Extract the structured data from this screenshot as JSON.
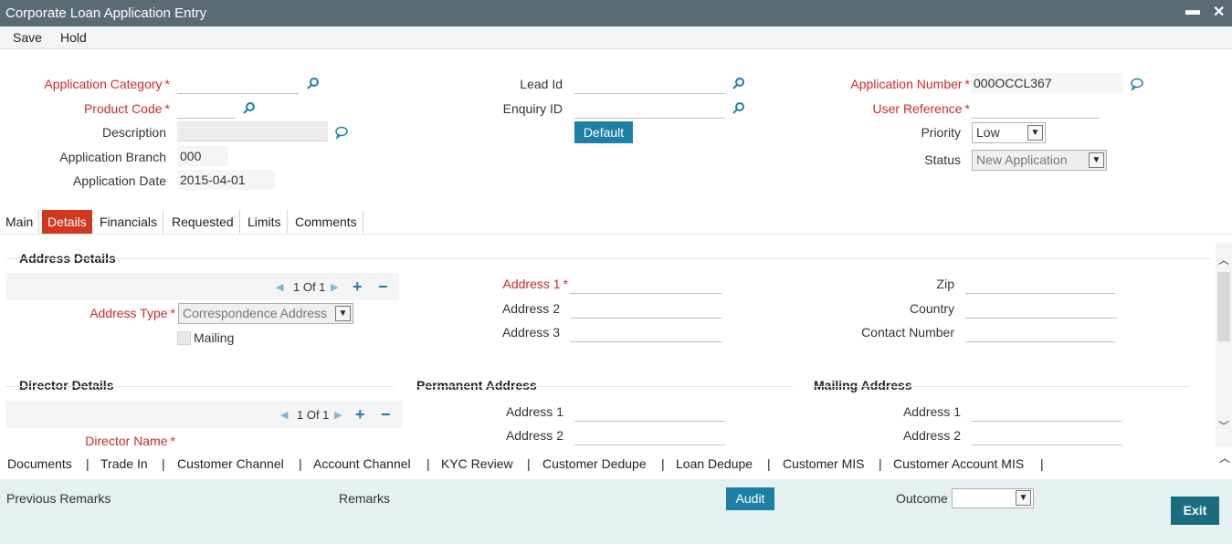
{
  "window": {
    "title": "Corporate Loan Application Entry",
    "minimize": "▬",
    "close": "✕"
  },
  "menu": {
    "save": "Save",
    "hold": "Hold"
  },
  "header": {
    "application_category": {
      "label": "Application Category",
      "value": ""
    },
    "product_code": {
      "label": "Product Code",
      "value": ""
    },
    "description": {
      "label": "Description",
      "value": ""
    },
    "application_branch": {
      "label": "Application Branch",
      "value": "000"
    },
    "application_date": {
      "label": "Application Date",
      "value": "2015-04-01"
    },
    "lead_id": {
      "label": "Lead Id",
      "value": ""
    },
    "enquiry_id": {
      "label": "Enquiry ID",
      "value": ""
    },
    "default_button": "Default",
    "application_number": {
      "label": "Application Number",
      "value": "000OCCL367"
    },
    "user_reference": {
      "label": "User Reference",
      "value": ""
    },
    "priority": {
      "label": "Priority",
      "value": "Low"
    },
    "status": {
      "label": "Status",
      "value": "New Application"
    },
    "required_mark": "*"
  },
  "tabs": [
    "Main",
    "Details",
    "Financials",
    "Requested",
    "Limits",
    "Comments"
  ],
  "active_tab": "Details",
  "address_details": {
    "title": "Address Details",
    "pager": "1 Of 1",
    "address_type": {
      "label": "Address Type",
      "value": "Correspondence Address"
    },
    "mailing_label": "Mailing",
    "address1": "Address 1",
    "address2": "Address 2",
    "address3": "Address 3",
    "zip": "Zip",
    "country": "Country",
    "contact_number": "Contact Number"
  },
  "director_details": {
    "title": "Director Details",
    "pager": "1 Of 1",
    "director_name": "Director Name",
    "permanent_address": {
      "title": "Permanent Address",
      "address1": "Address 1",
      "address2": "Address 2"
    },
    "mailing_address": {
      "title": "Mailing Address",
      "address1": "Address 1",
      "address2": "Address 2"
    }
  },
  "links": [
    "Documents",
    "Trade In",
    "Customer Channel",
    "Account Channel",
    "KYC Review",
    "Customer Dedupe",
    "Loan Dedupe",
    "Customer MIS",
    "Customer Account MIS"
  ],
  "link_separator": "|",
  "footer": {
    "previous_remarks": "Previous Remarks",
    "remarks": "Remarks",
    "audit": "Audit",
    "outcome": "Outcome",
    "outcome_value": "",
    "exit": "Exit"
  },
  "colors": {
    "accent": "#1c7fa6",
    "required": "#cc2a2a",
    "active_tab": "#d0381f",
    "titlebar": "#5a6b73"
  }
}
